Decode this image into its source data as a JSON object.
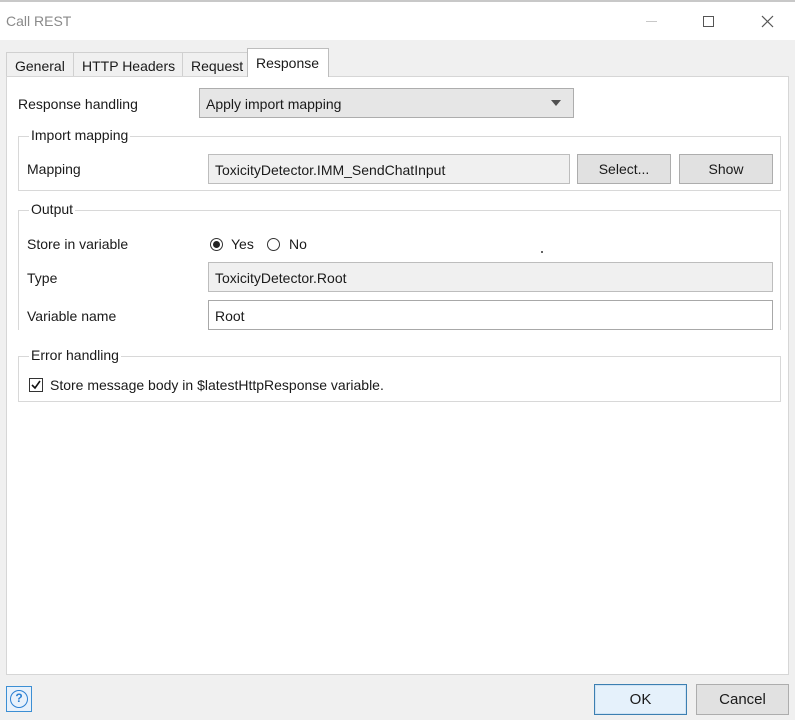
{
  "window": {
    "title": "Call REST"
  },
  "tabs": [
    {
      "label": "General"
    },
    {
      "label": "HTTP Headers"
    },
    {
      "label": "Request"
    },
    {
      "label": "Response"
    }
  ],
  "response_handling": {
    "label": "Response handling",
    "value": "Apply import mapping"
  },
  "import_mapping": {
    "legend": "Import mapping",
    "mapping_label": "Mapping",
    "mapping_value": "ToxicityDetector.IMM_SendChatInput",
    "select_label": "Select...",
    "show_label": "Show"
  },
  "output": {
    "legend": "Output",
    "store_label": "Store in variable",
    "yes_label": "Yes",
    "no_label": "No",
    "store_selected": "Yes",
    "type_label": "Type",
    "type_value": "ToxicityDetector.Root",
    "varname_label": "Variable name",
    "varname_value": "Root"
  },
  "error_handling": {
    "legend": "Error handling",
    "checkbox_label": "Store message body in $latestHttpResponse variable.",
    "checked": true
  },
  "footer": {
    "ok_label": "OK",
    "cancel_label": "Cancel"
  },
  "icons": {
    "help": "help-icon",
    "close": "close-icon",
    "maximize": "maximize-icon",
    "minimize": "minimize-icon"
  }
}
